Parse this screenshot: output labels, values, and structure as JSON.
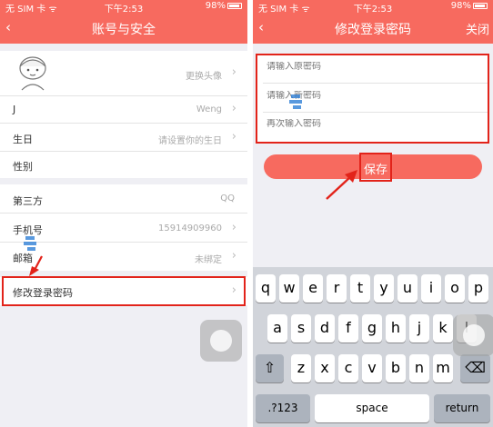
{
  "left_screen": {
    "status": {
      "carrier": "无 SIM 卡 ᯤ",
      "time": "下午2:53",
      "battery": "98%"
    },
    "nav": {
      "back": "‹",
      "title": "账号与安全"
    },
    "avatar_row": {
      "value": "更换头像"
    },
    "rows": [
      {
        "label": "J",
        "value": "Weng"
      },
      {
        "label": "生日",
        "value": "请设置你的生日"
      },
      {
        "label": "性别",
        "value": ""
      }
    ],
    "bind_rows": [
      {
        "label": "第三方",
        "value": "QQ"
      },
      {
        "label": "手机号",
        "value": "15914909960"
      },
      {
        "label": "邮箱",
        "value": "未绑定"
      }
    ],
    "password_row": {
      "label": "修改登录密码"
    }
  },
  "right_screen": {
    "status": {
      "carrier": "无 SIM 卡 ᯤ",
      "time": "下午2:53",
      "battery": "98%"
    },
    "nav": {
      "back": "‹",
      "title": "修改登录密码",
      "close": "关闭"
    },
    "fields": {
      "old_placeholder": "请输入原密码",
      "new_placeholder": "请输入新密码",
      "confirm_placeholder": "再次输入密码"
    },
    "save_label": "保存",
    "keyboard": {
      "row1": [
        "q",
        "w",
        "e",
        "r",
        "t",
        "y",
        "u",
        "i",
        "o",
        "p"
      ],
      "row2": [
        "a",
        "s",
        "d",
        "f",
        "g",
        "h",
        "j",
        "k",
        "l"
      ],
      "row3": [
        "z",
        "x",
        "c",
        "v",
        "b",
        "n",
        "m"
      ],
      "shift": "⇧",
      "delete": "⌫",
      "numbers": ".?123",
      "space": "space",
      "return": "return"
    }
  },
  "colors": {
    "brand": "#f76a5f",
    "highlight": "#e2231a",
    "background": "#efeff4"
  },
  "chevron": "›"
}
